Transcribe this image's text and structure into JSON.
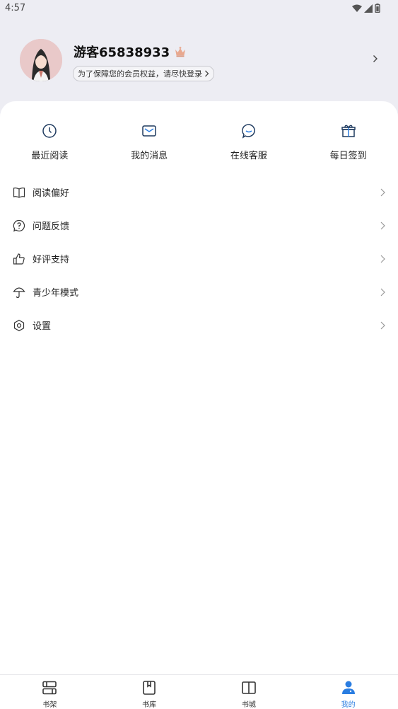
{
  "status": {
    "time": "4:57"
  },
  "profile": {
    "username": "游客65838933",
    "login_tip": "为了保障您的会员权益，请尽快登录"
  },
  "quick_actions": [
    {
      "label": "最近阅读",
      "icon": "clock-icon"
    },
    {
      "label": "我的消息",
      "icon": "mail-icon"
    },
    {
      "label": "在线客服",
      "icon": "chat-icon"
    },
    {
      "label": "每日签到",
      "icon": "gift-icon"
    }
  ],
  "menu": [
    {
      "label": "阅读偏好",
      "icon": "book-open-icon"
    },
    {
      "label": "问题反馈",
      "icon": "question-bubble-icon"
    },
    {
      "label": "好评支持",
      "icon": "thumbs-up-icon"
    },
    {
      "label": "青少年模式",
      "icon": "umbrella-icon"
    },
    {
      "label": "设置",
      "icon": "settings-icon"
    }
  ],
  "tabs": [
    {
      "label": "书架",
      "icon": "bookshelf-icon",
      "active": false
    },
    {
      "label": "书库",
      "icon": "library-icon",
      "active": false
    },
    {
      "label": "书城",
      "icon": "bookstore-icon",
      "active": false
    },
    {
      "label": "我的",
      "icon": "profile-icon",
      "active": true
    }
  ],
  "colors": {
    "accent": "#2a7de1",
    "header_bg": "#ededf3",
    "crown": "#e8a88f"
  }
}
